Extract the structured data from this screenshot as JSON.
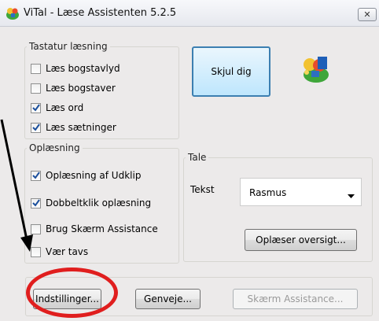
{
  "window": {
    "title": "ViTal - Læse Assistenten 5.2.5",
    "close_label": "✕"
  },
  "tastatur": {
    "legend": "Tastatur læsning",
    "items": [
      {
        "label": "Læs bogstavlyd",
        "checked": false
      },
      {
        "label": "Læs bogstaver",
        "checked": false
      },
      {
        "label": "Læs ord",
        "checked": true
      },
      {
        "label": "Læs sætninger",
        "checked": true
      }
    ]
  },
  "hide_button": {
    "label": "Skjul dig"
  },
  "oplaesning": {
    "legend": "Oplæsning",
    "items": [
      {
        "label": "Oplæsning af Udklip",
        "checked": true
      },
      {
        "label": "Dobbeltklik oplæsning",
        "checked": true
      },
      {
        "label": "Brug Skærm Assistance",
        "checked": false
      },
      {
        "label": "Vær tavs",
        "checked": false
      }
    ]
  },
  "tale": {
    "legend": "Tale",
    "tekst_label": "Tekst",
    "voice_selected": "Rasmus",
    "overview_button": "Oplæser oversigt..."
  },
  "bottom": {
    "settings_button": "Indstillinger...",
    "shortcuts_button": "Genveje...",
    "screen_assist_button": "Skærm Assistance..."
  },
  "colors": {
    "annotation": "#e01e1e",
    "check": "#1b4f9c",
    "primary_border": "#3c7fb1"
  }
}
